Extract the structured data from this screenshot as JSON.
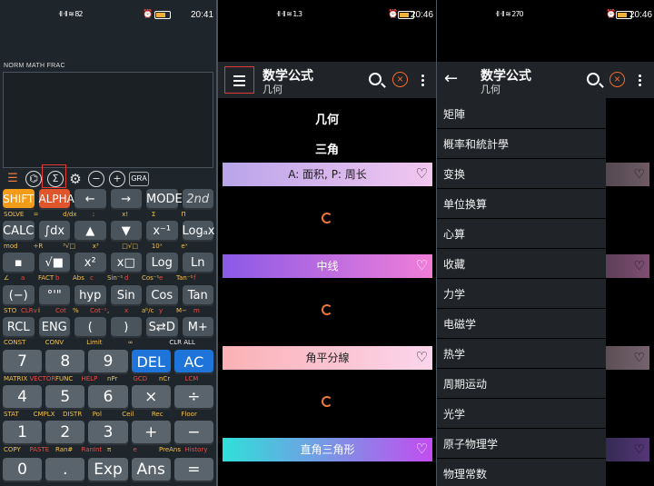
{
  "status": {
    "p1": {
      "net": "·ll ·ll ≋ 82",
      "battery": 66,
      "time": "20:41"
    },
    "p2": {
      "net": "·ll ·ll ≋ 1.3",
      "battery": 64,
      "time": "20:46"
    },
    "p3": {
      "net": "·ll ·ll ≋ 270",
      "battery": 64,
      "time": "20:46"
    }
  },
  "calculator": {
    "modes": "NORM  MATH  FRAC",
    "tool_gra": "GRA",
    "rows": [
      {
        "keys": [
          "SHIFT",
          "ALPHA",
          "←",
          "→",
          "MODE",
          "2nd"
        ],
        "subs": [
          "SOLVE",
          "=",
          "d/dx",
          ":",
          "x!",
          "Σ",
          "Π"
        ]
      },
      {
        "keys": [
          "CALC",
          "∫dx",
          "▲",
          "▼",
          "x⁻¹",
          "Logₐx"
        ],
        "subs": [
          "mod",
          "÷R",
          "³√□",
          "x³",
          "□√□",
          "10ˣ",
          "eˣ"
        ]
      },
      {
        "keys": [
          "▪",
          "√■",
          "x²",
          "x□",
          "Log",
          "Ln"
        ],
        "subs": [
          "∠",
          "a",
          "FACT",
          "b",
          "Abs",
          "c",
          "Sin⁻¹",
          "d",
          "Cos⁻¹",
          "e",
          "Tan⁻¹",
          "f"
        ]
      },
      {
        "keys": [
          "(−)",
          "°'\"",
          "hyp",
          "Sin",
          "Cos",
          "Tan"
        ],
        "subs": [
          "STO",
          "CLRv",
          "i",
          "Cot",
          "%",
          "Cot⁻¹",
          ",",
          "x",
          "aᵇ/c",
          "y",
          "M−",
          "m"
        ]
      },
      {
        "keys": [
          "RCL",
          "ENG",
          "(",
          ")",
          "S⇄D",
          "M+"
        ],
        "subs": [
          "CONST",
          "CONV",
          "Limit",
          "∞",
          "CLR ALL"
        ]
      },
      {
        "keys": [
          "7",
          "8",
          "9",
          "DEL",
          "AC"
        ],
        "subs": [
          "MATRIX",
          "VECTOR",
          "FUNC",
          "HELP",
          "nPr",
          "GCD",
          "nCr",
          "LCM"
        ]
      },
      {
        "keys": [
          "4",
          "5",
          "6",
          "×",
          "÷"
        ],
        "subs": [
          "STAT",
          "CMPLX",
          "DISTR",
          "Pol",
          "Ceil",
          "Rec",
          "Floor"
        ]
      },
      {
        "keys": [
          "1",
          "2",
          "3",
          "+",
          "−"
        ],
        "subs": [
          "COPY",
          "PASTE",
          "Ran#",
          "RanInt",
          "π",
          "e",
          "PreAns",
          "History"
        ]
      },
      {
        "keys": [
          "0",
          ".",
          "Exp",
          "Ans",
          "="
        ]
      }
    ]
  },
  "formula_view": {
    "title": "数学公式",
    "subtitle": "几何",
    "headings": [
      "几何",
      "三角"
    ],
    "cards": [
      {
        "label": "A: 面积, P: 周长",
        "grad": "#b9a4ea,#f2c7ef"
      },
      {
        "label": "中线",
        "grad": "#8a5ae6,#f07ed8"
      },
      {
        "label": "角平分線",
        "grad": "#fbb1b5,#fbd5ec"
      },
      {
        "label": "直角三角形",
        "grad": "#2fe0d9,#c24df0"
      }
    ]
  },
  "drawer_view": {
    "title": "数学公式",
    "subtitle": "几何",
    "items": [
      "矩陣",
      "概率和統計學",
      "变换",
      "单位换算",
      "心算",
      "收藏",
      "力学",
      "电磁学",
      "热学",
      "周期运动",
      "光学",
      "原子物理学",
      "物理常数"
    ]
  }
}
